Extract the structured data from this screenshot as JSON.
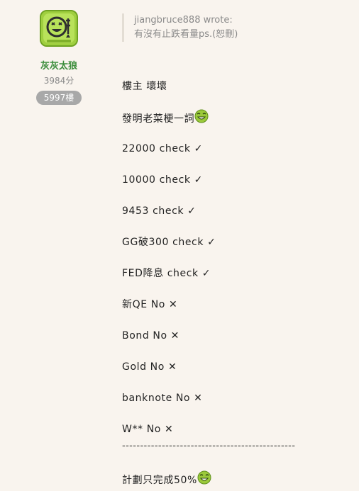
{
  "author": {
    "avatar_icon": "smiling-ghost-sticker-icon",
    "username": "灰灰太狼",
    "points": "3984分",
    "floor": "5997樓"
  },
  "quote": {
    "header": "jiangbruce888 wrote:",
    "text": "有沒有止跌看量ps.(恕刪)"
  },
  "post": {
    "lines": [
      {
        "text": "樓主 壞壞",
        "mark": ""
      },
      {
        "text": "發明老菜梗一詞",
        "mark": "emoji"
      },
      {
        "text": "22000 check ",
        "mark": "✓"
      },
      {
        "text": "10000 check ",
        "mark": "✓"
      },
      {
        "text": "9453 check ",
        "mark": "✓"
      },
      {
        "text": "GG破300 check ",
        "mark": "✓"
      },
      {
        "text": "FED降息 check ",
        "mark": "✓"
      },
      {
        "text": "新QE No ",
        "mark": "✕"
      },
      {
        "text": "Bond No ",
        "mark": "✕"
      },
      {
        "text": "Gold No ",
        "mark": "✕"
      },
      {
        "text": "banknote No ",
        "mark": "✕"
      },
      {
        "text": "W** No ",
        "mark": "✕"
      }
    ],
    "divider": "------------------------------------------------",
    "final_text": "計劃只完成50%",
    "emoji_icon": "green-grinning-face-icon"
  },
  "colors": {
    "background": "#f9f4ee",
    "username": "#3b8d3b",
    "badge": "#a8a8a8",
    "avatar_green": "#a9d54b"
  }
}
